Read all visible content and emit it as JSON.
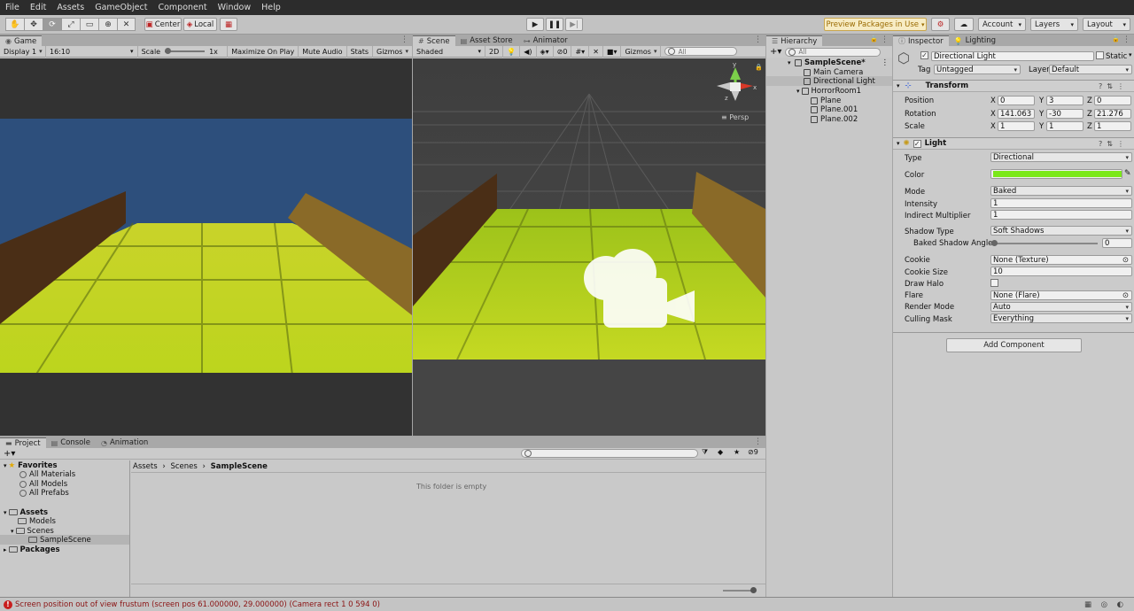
{
  "menu": [
    "File",
    "Edit",
    "Assets",
    "GameObject",
    "Component",
    "Window",
    "Help"
  ],
  "toolbar": {
    "tools": [
      "hand-icon",
      "move-icon",
      "rotate-icon",
      "scale-icon",
      "rect-icon",
      "transform-icon",
      "custom-tool-icon"
    ],
    "pivot": "Center",
    "space": "Local",
    "preview_packages": "Preview Packages in Use",
    "account": "Account",
    "layers": "Layers",
    "layout": "Layout"
  },
  "game": {
    "tab": "Game",
    "display": "Display 1",
    "aspect": "16:10",
    "scale_label": "Scale",
    "scale_value": "1x",
    "maximize": "Maximize On Play",
    "mute": "Mute Audio",
    "stats": "Stats",
    "gizmos": "Gizmos"
  },
  "scene": {
    "tabs": [
      "Scene",
      "Asset Store",
      "Animator"
    ],
    "shading": "Shaded",
    "mode2d": "2D",
    "hidden_count": "0",
    "gizmos": "Gizmos",
    "search_placeholder": "All",
    "persp": "Persp",
    "axes": {
      "y": "y",
      "x": "x",
      "z": "z"
    }
  },
  "hierarchy": {
    "tab": "Hierarchy",
    "search_placeholder": "All",
    "scene": "SampleScene*",
    "items": [
      "Main Camera",
      "Directional Light",
      "HorrorRoom1",
      "Plane",
      "Plane.001",
      "Plane.002"
    ]
  },
  "inspector": {
    "tabs": [
      "Inspector",
      "Lighting"
    ],
    "object_name": "Directional Light",
    "static": "Static",
    "tag_label": "Tag",
    "tag": "Untagged",
    "layer_label": "Layer",
    "layer": "Default",
    "transform": {
      "title": "Transform",
      "position_label": "Position",
      "rotation_label": "Rotation",
      "scale_label": "Scale",
      "axes": [
        "X",
        "Y",
        "Z"
      ],
      "position": [
        "0",
        "3",
        "0"
      ],
      "rotation": [
        "141.063",
        "-30",
        "21.276"
      ],
      "scale": [
        "1",
        "1",
        "1"
      ]
    },
    "light": {
      "title": "Light",
      "type_label": "Type",
      "type": "Directional",
      "color_label": "Color",
      "color": "#7be81a",
      "mode_label": "Mode",
      "mode": "Baked",
      "intensity_label": "Intensity",
      "intensity": "1",
      "indirect_label": "Indirect Multiplier",
      "indirect": "1",
      "shadow_type_label": "Shadow Type",
      "shadow_type": "Soft Shadows",
      "baked_angle_label": "Baked Shadow Angle",
      "baked_angle": "0",
      "cookie_label": "Cookie",
      "cookie": "None (Texture)",
      "cookie_size_label": "Cookie Size",
      "cookie_size": "10",
      "draw_halo_label": "Draw Halo",
      "flare_label": "Flare",
      "flare": "None (Flare)",
      "render_mode_label": "Render Mode",
      "render_mode": "Auto",
      "culling_mask_label": "Culling Mask",
      "culling_mask": "Everything"
    },
    "add_component": "Add Component"
  },
  "project": {
    "tabs": [
      "Project",
      "Console",
      "Animation"
    ],
    "hidden_count": "9",
    "favorites": "Favorites",
    "favorite_items": [
      "All Materials",
      "All Models",
      "All Prefabs"
    ],
    "assets": "Assets",
    "asset_items": [
      "Models",
      "Scenes"
    ],
    "scene_folder": "SampleScene",
    "packages": "Packages",
    "breadcrumb": [
      "Assets",
      "Scenes",
      "SampleScene"
    ],
    "empty_message": "This folder is empty"
  },
  "status": "Screen position out of view frustum (screen pos 61.000000, 29.000000) (Camera rect 1 0 594 0)"
}
